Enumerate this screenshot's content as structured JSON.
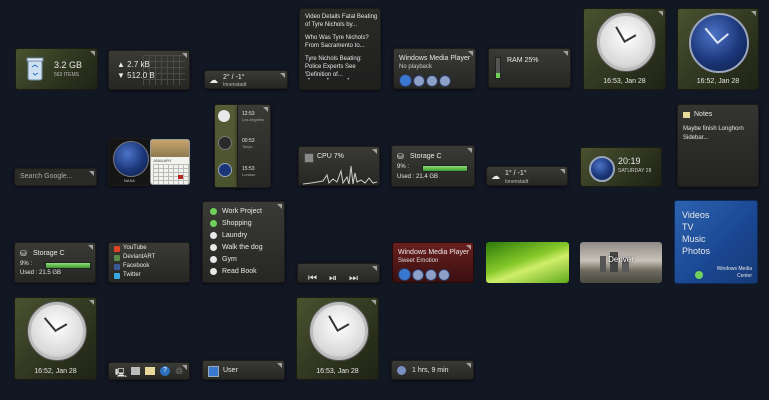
{
  "recycle_bin": {
    "size": "3.2 GB",
    "items": "563 ITEMS"
  },
  "network": {
    "up": "2.7 kB",
    "down": "512.0 B"
  },
  "weather": [
    {
      "temp": "2° / -1°",
      "city": "Innenstadt"
    },
    {
      "temp": "1° / -1°",
      "city": "Innenstadt"
    }
  ],
  "news": {
    "items": [
      "Video Details Fatal Beating of Tyre Nichols by...",
      "Who Was Tyre Nichols? From Sacramento to...",
      "Tyre Nichols Beating: Police Experts See 'Definition of..."
    ]
  },
  "media_player": {
    "title": "Windows Media Player",
    "status": "No playback",
    "track": "Sweet Emotion"
  },
  "ram": {
    "label": "RAM 25%",
    "percent": 25
  },
  "clocks": {
    "top_white": "16:53, Jan 28",
    "top_blue": "16:52, Jan 28",
    "bottom_left": "16:52, Jan 28",
    "bottom_mid": "16:53, Jan 28"
  },
  "world_clocks": [
    {
      "time": "12:53",
      "label": "Los Angeles"
    },
    {
      "time": "00:53",
      "label": "Tokyo"
    },
    {
      "time": "15:53",
      "label": "London"
    }
  ],
  "slideshow": {
    "caption": "NASA"
  },
  "calendar": {
    "month": "JANUARY"
  },
  "cpu": {
    "label": "CPU 7%",
    "percent": 7
  },
  "storage": [
    {
      "name": "Storage C",
      "percent": "9% :",
      "used": "Used : 21.4 GB",
      "fill": 9
    },
    {
      "name": "Storage C",
      "percent": "9% :",
      "used": "Used : 21.5 GB",
      "fill": 9
    }
  ],
  "digital_clock": {
    "time": "20:19",
    "date": "SATURDAY 28"
  },
  "notes": {
    "title": "Notes",
    "body": "Maybe finish Longhorn Sidebar..."
  },
  "search": {
    "placeholder": "Search Google..."
  },
  "todo": [
    "Work Project",
    "Shopping",
    "Laundry",
    "Walk the dog",
    "Gym",
    "Read Book"
  ],
  "links": [
    "YouTube",
    "DeviantART",
    "Facebook",
    "Twitter"
  ],
  "media_center": {
    "items": [
      "Videos",
      "TV",
      "Music",
      "Photos"
    ],
    "brand": "Windows Media Center"
  },
  "photo": {
    "city": "Denver"
  },
  "user": {
    "label": "User"
  },
  "battery": {
    "label": "1 hrs, 9 min"
  },
  "colors": {
    "accent_green": "#6fd15a",
    "media_blue": "#2d6fbf",
    "bg": "#121724"
  }
}
